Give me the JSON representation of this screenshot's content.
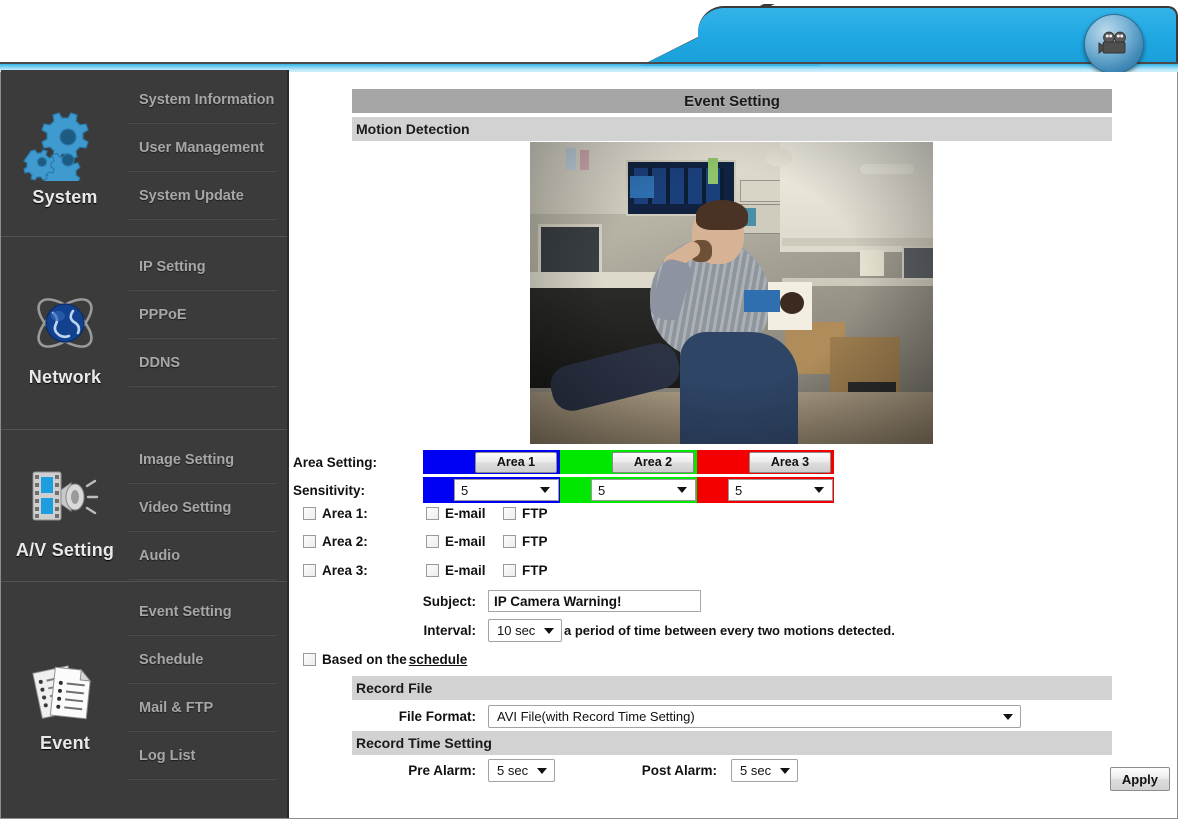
{
  "header": {
    "camera_icon": "movie-camera-icon"
  },
  "sidebar": {
    "groups": [
      {
        "title": "System",
        "icon": "gears-icon",
        "items": [
          {
            "label": "System Information"
          },
          {
            "label": "User Management"
          },
          {
            "label": "System Update"
          }
        ]
      },
      {
        "title": "Network",
        "icon": "globe-network-icon",
        "items": [
          {
            "label": "IP Setting"
          },
          {
            "label": "PPPoE"
          },
          {
            "label": "DDNS"
          }
        ]
      },
      {
        "title": "A/V Setting",
        "icon": "film-speaker-icon",
        "items": [
          {
            "label": "Image Setting"
          },
          {
            "label": "Video Setting"
          },
          {
            "label": "Audio"
          }
        ]
      },
      {
        "title": "Event",
        "icon": "documents-list-icon",
        "items": [
          {
            "label": "Event Setting"
          },
          {
            "label": "Schedule"
          },
          {
            "label": "Mail & FTP"
          },
          {
            "label": "Log List"
          }
        ]
      }
    ]
  },
  "main": {
    "page_title": "Event Setting",
    "sections": {
      "motion_detection": "Motion Detection",
      "record_file": "Record File",
      "record_time_setting": "Record Time Setting"
    },
    "area_setting": {
      "label": "Area Setting:",
      "areas": [
        {
          "button": "Area 1",
          "color": "#0000f4"
        },
        {
          "button": "Area 2",
          "color": "#00e800"
        },
        {
          "button": "Area 3",
          "color": "#f40000"
        }
      ]
    },
    "sensitivity": {
      "label": "Sensitivity:",
      "values": [
        "5",
        "5",
        "5"
      ]
    },
    "area_rows": [
      {
        "label": "Area 1:",
        "checked": false,
        "email_label": "E-mail",
        "email_checked": false,
        "ftp_label": "FTP",
        "ftp_checked": false
      },
      {
        "label": "Area 2:",
        "checked": false,
        "email_label": "E-mail",
        "email_checked": false,
        "ftp_label": "FTP",
        "ftp_checked": false
      },
      {
        "label": "Area 3:",
        "checked": false,
        "email_label": "E-mail",
        "email_checked": false,
        "ftp_label": "FTP",
        "ftp_checked": false
      }
    ],
    "subject": {
      "label": "Subject:",
      "value": "IP Camera Warning!"
    },
    "interval": {
      "label": "Interval:",
      "value": "10 sec",
      "hint": "a period of time between every two motions detected."
    },
    "schedule": {
      "checked": false,
      "text_before": "Based on the ",
      "link": "schedule"
    },
    "file_format": {
      "label": "File Format:",
      "value": "AVI File(with Record Time Setting)"
    },
    "pre_alarm": {
      "label": "Pre Alarm:",
      "value": "5 sec"
    },
    "post_alarm": {
      "label": "Post Alarm:",
      "value": "5 sec"
    },
    "apply_label": "Apply"
  }
}
